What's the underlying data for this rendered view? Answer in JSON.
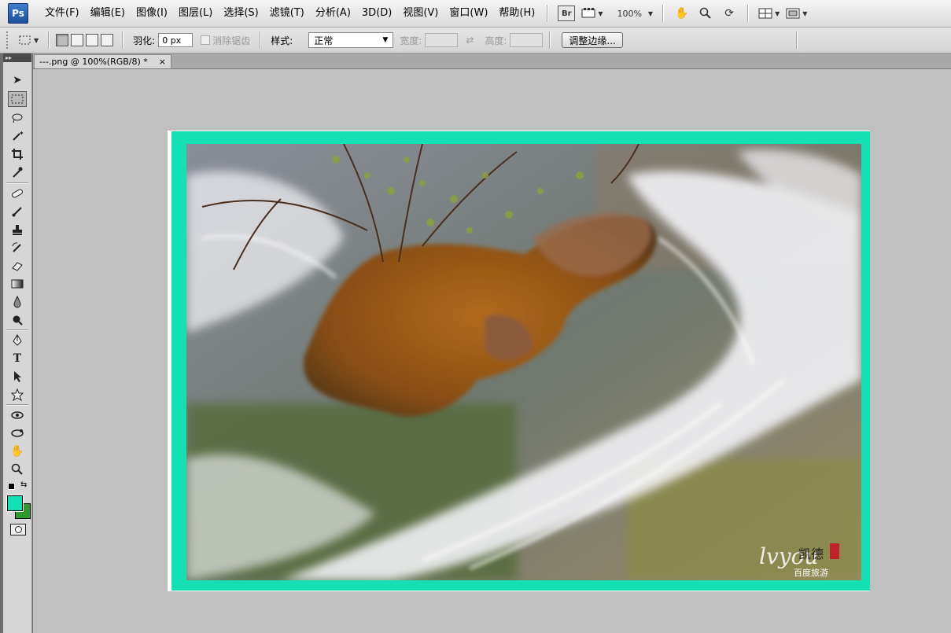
{
  "app": {
    "logo": "Ps"
  },
  "menu": [
    "文件(F)",
    "编辑(E)",
    "图像(I)",
    "图层(L)",
    "选择(S)",
    "滤镜(T)",
    "分析(A)",
    "3D(D)",
    "视图(V)",
    "窗口(W)",
    "帮助(H)"
  ],
  "appbar": {
    "bridge_label": "Br",
    "zoom": "100%"
  },
  "options": {
    "feather_label": "羽化:",
    "feather_value": "0 px",
    "antialias_label": "消除锯齿",
    "style_label": "样式:",
    "style_value": "正常",
    "width_label": "宽度:",
    "height_label": "高度:",
    "refine_label": "调整边缘..."
  },
  "document": {
    "tab_title": "---.png @ 100%(RGB/8) *",
    "close_glyph": "×"
  },
  "watermark": {
    "brand": "lvyou",
    "name": "凯德",
    "sub": "百度旅游"
  },
  "colors": {
    "foreground": "#14e0b4",
    "background": "#2e9a2e",
    "frame": "#14e0b4"
  }
}
